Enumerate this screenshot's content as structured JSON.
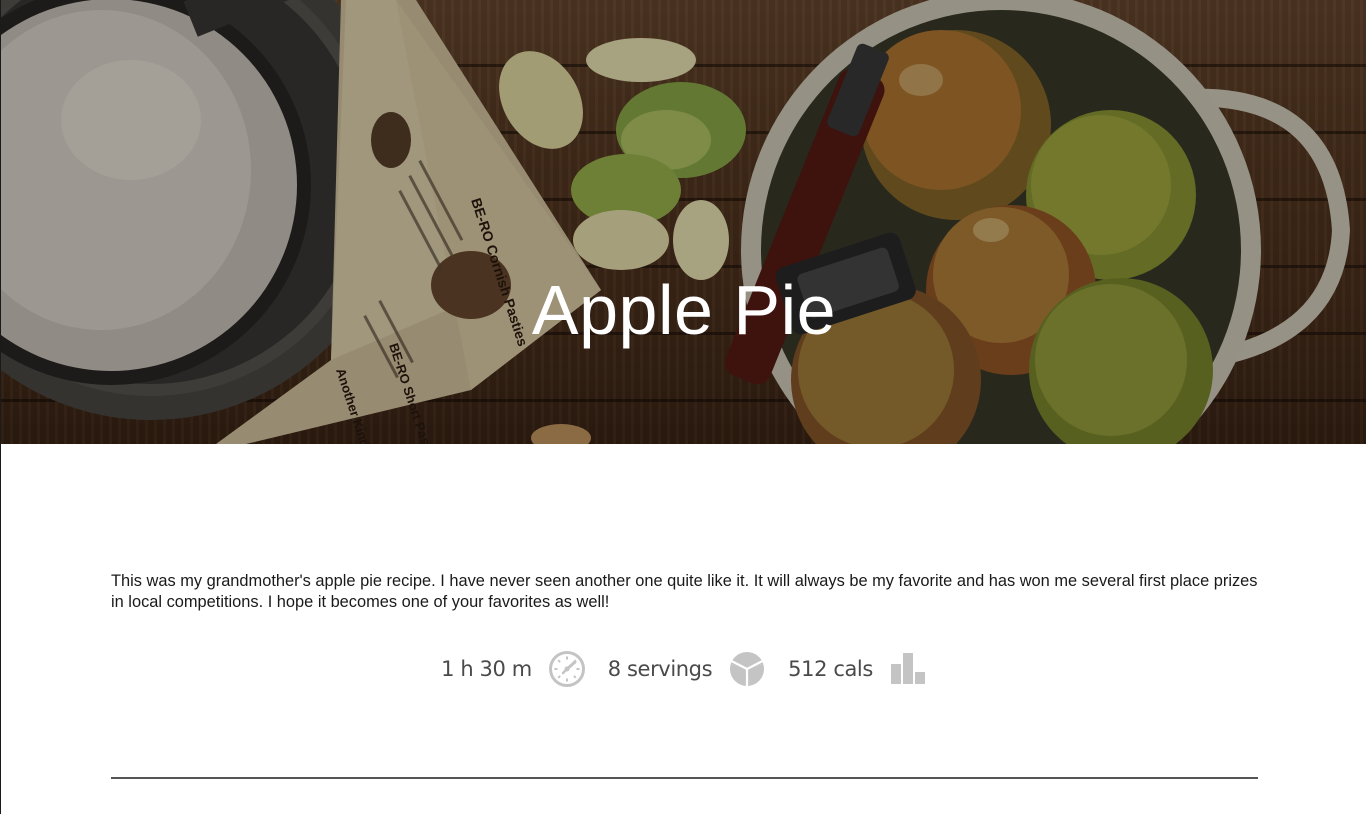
{
  "recipe": {
    "title": "Apple Pie",
    "description": "This was my grandmother's apple pie recipe. I have never seen another one quite like it. It will always be my favorite and has won me several first place prizes in local competitions. I hope it becomes one of your favorites as well!"
  },
  "stats": {
    "time": {
      "label": "1 h 30 m",
      "icon": "clock-icon"
    },
    "servings": {
      "label": "8 servings",
      "icon": "pie-icon"
    },
    "calories": {
      "label": "512 cals",
      "icon": "bar-chart-icon"
    }
  },
  "colors": {
    "title_text": "#ffffff",
    "body_text": "#1a1a1a",
    "stat_text": "#4a4a4a",
    "stat_icon": "#c4c4c4",
    "divider": "#555555"
  },
  "hero_image": {
    "icon": "hero-photo",
    "book_text": [
      "BE-RO Cornish Pasties",
      "BE-RO Short Pastry",
      "Another Kind of Pastry"
    ]
  }
}
